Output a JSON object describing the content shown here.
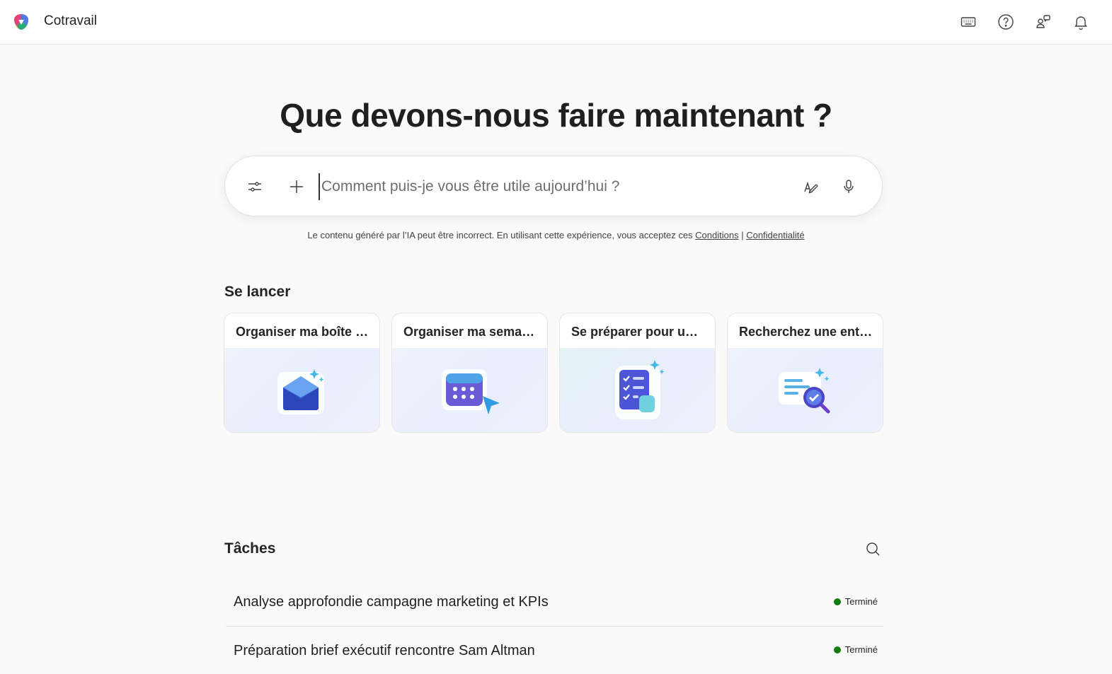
{
  "app": {
    "title": "Cotravail",
    "logo_icon": "copilot-logo-icon"
  },
  "topbar": {
    "icons": [
      "keyboard-icon",
      "help-icon",
      "people-icon",
      "bell-icon"
    ]
  },
  "hero": {
    "headline": "Que devons-nous faire maintenant ?"
  },
  "prompt": {
    "placeholder": "Comment puis-je vous être utile aujourd’hui ?",
    "value": ""
  },
  "disclaimer": {
    "text": "Le contenu généré par l’IA peut être incorrect. En utilisant cette expérience, vous acceptez ces ",
    "terms_link": "Conditions",
    "separator": " | ",
    "privacy_link": "Confidentialité"
  },
  "get_started": {
    "title": "Se lancer",
    "cards": [
      {
        "label": "Organiser ma boîte de réception",
        "icon": "mail-envelope-icon"
      },
      {
        "label": "Organiser ma semaine",
        "icon": "calendar-cursor-icon"
      },
      {
        "label": "Se préparer pour une réunion",
        "icon": "checklist-icon"
      },
      {
        "label": "Recherchez une entreprise",
        "icon": "document-search-icon"
      }
    ]
  },
  "tasks": {
    "title": "Tâches",
    "items": [
      {
        "name": "Analyse approfondie campagne marketing et KPIs",
        "status": "Terminé"
      },
      {
        "name": "Préparation brief exécutif rencontre Sam Altman",
        "status": "Terminé"
      }
    ]
  },
  "colors": {
    "status_done": "#107c10",
    "accent": "#4f52d8"
  }
}
